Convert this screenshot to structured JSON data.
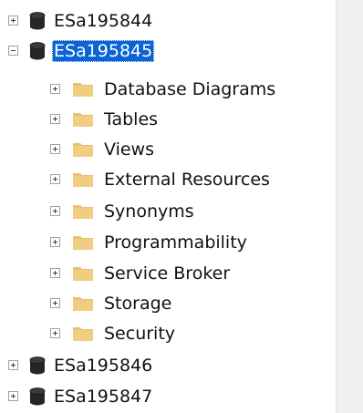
{
  "colors": {
    "selection": "#0a64d6",
    "folder": "#e8c170",
    "database": "#262626",
    "side_strip": "#f0f0f0"
  },
  "icons": {
    "expander_collapsed": "plus-box-icon",
    "expander_expanded": "minus-box-icon",
    "database": "database-cylinder-icon",
    "folder": "folder-icon"
  },
  "tree": {
    "databases": [
      {
        "name": "ESa195844",
        "expanded": false,
        "selected": false
      },
      {
        "name": "ESa195845",
        "expanded": true,
        "selected": true
      },
      {
        "name": "ESa195846",
        "expanded": false,
        "selected": false
      },
      {
        "name": "ESa195847",
        "expanded": false,
        "selected": false
      }
    ],
    "folders": [
      {
        "name": "Database Diagrams"
      },
      {
        "name": "Tables"
      },
      {
        "name": "Views"
      },
      {
        "name": "External Resources"
      },
      {
        "name": "Synonyms"
      },
      {
        "name": "Programmability"
      },
      {
        "name": "Service Broker"
      },
      {
        "name": "Storage"
      },
      {
        "name": "Security"
      }
    ]
  }
}
